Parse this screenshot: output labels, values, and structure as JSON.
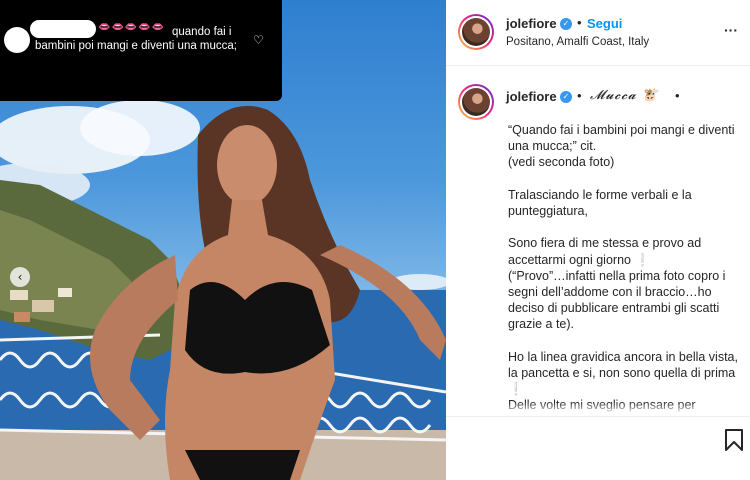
{
  "comment_overlay": {
    "emojis": "👄👄👄👄👄",
    "text_line1": "quando fai i",
    "text_line2": "bambini poi mangi e diventi una mucca;",
    "like_icon": "heart-outline-icon"
  },
  "carousel": {
    "prev_icon": "chevron-left-icon"
  },
  "post_header": {
    "username": "jolefiore",
    "verified_icon": "verified-badge-icon",
    "separator": "•",
    "follow_label": "Segui",
    "location": "Positano, Amalfi Coast, Italy",
    "more_icon": "more-horizontal-icon"
  },
  "caption": {
    "username": "jolefiore",
    "separator": "•",
    "title": "𝓜𝓾𝓬𝓬𝓪 🐮",
    "trailing_separator": "•",
    "body": "“Quando fai i bambini poi mangi e diventi una mucca;” cit.\n(vedi seconda foto)\n\nTralasciando le forme verbali e la punteggiatura,\n\nSono fiera di me stessa e provo ad accettarmi ogni giorno ❕\n(“Provo”…infatti nella prima foto copro i segni dell’addome con il braccio…ho deciso di pubblicare entrambi gli scatti grazie a te).\n\nHo la linea gravidica ancora in bella vista, la pancetta e si, non sono quella di prima ❕\nDelle volte mi sveglio pensare per"
  },
  "actions": {
    "save_icon": "bookmark-icon"
  },
  "colors": {
    "link_blue": "#0095f6",
    "verified_blue": "#3897f0",
    "text_dark": "#262626",
    "divider": "#efefef"
  }
}
